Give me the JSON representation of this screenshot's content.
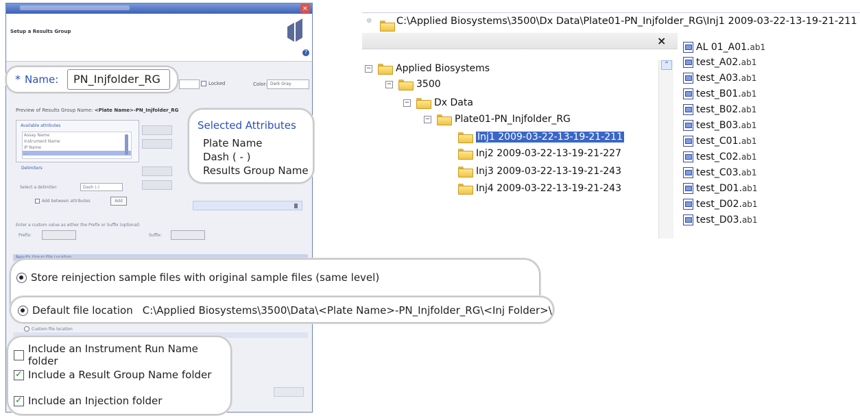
{
  "dialog": {
    "title_blurred": "",
    "setup_heading": "Setup a Results Group",
    "name_label": "Name:",
    "name_required_star": "*",
    "name_value": "PN_Injfolder_RG",
    "locked_label": "Locked",
    "color_label": "Color:",
    "color_value": "Dark Gray",
    "preview_label": "Preview of Results Group Name: ",
    "preview_value": "<Plate Name>-PN_Injfolder_RG",
    "available_attributes_header": "Available attributes",
    "available_attributes": [
      "Assay Name",
      "Instrument Name",
      "IP Name",
      "..."
    ],
    "delimiters_header": "Delimiters",
    "select_delimiter_label": "Select a delimiter:",
    "select_delimiter_value": "Dash (-)",
    "add_delimiter_label": "Add between attributes",
    "add_button": "Add",
    "custom_value_label": "Enter a custom value as either the Prefix or Suffix (optional)",
    "prefix_label": "Prefix:",
    "suffix_label": "Suffix:",
    "file_location_section": "Results Group File Location",
    "custom_location_label": "Custom file location",
    "selected_attributes": {
      "title": "Selected Attributes",
      "items": [
        "Plate Name",
        "Dash ( - )",
        "Results Group Name"
      ]
    },
    "store_reinjection": "Store reinjection sample files with original sample files (same level)",
    "default_location_label": "Default file location",
    "default_location_path": "C:\\Applied Biosystems\\3500\\Data\\<Plate Name>-PN_Injfolder_RG\\<Inj Folder>\\",
    "checkboxes": [
      {
        "label": "Include an Instrument Run Name folder",
        "checked": false
      },
      {
        "label": "Include a Result Group Name folder",
        "checked": true
      },
      {
        "label": "Include an Injection folder",
        "checked": true
      }
    ]
  },
  "explorer": {
    "address_path": "C:\\Applied Biosystems\\3500\\Dx Data\\Plate01-PN_Injfolder_RG\\Inj1 2009-03-22-13-19-21-211",
    "close_symbol": "×",
    "tree": [
      {
        "label": "Applied Biosystems",
        "expander": "⊟"
      },
      {
        "label": "3500",
        "expander": "⊟"
      },
      {
        "label": "Dx Data",
        "expander": "⊟"
      },
      {
        "label": "Plate01-PN_Injfolder_RG",
        "expander": "⊟"
      },
      {
        "label": "Inj1 2009-03-22-13-19-21-211",
        "selected": true
      },
      {
        "label": "Inj2 2009-03-22-13-19-21-227"
      },
      {
        "label": "Inj3 2009-03-22-13-19-21-243"
      },
      {
        "label": "Inj4 2009-03-22-13-19-21-243"
      }
    ],
    "files": [
      {
        "name": "AL 01_A01.",
        "ext": "ab1"
      },
      {
        "name": "test_A02.",
        "ext": "ab1"
      },
      {
        "name": "test_A03.",
        "ext": "ab1"
      },
      {
        "name": "test_B01.",
        "ext": "ab1"
      },
      {
        "name": "test_B02.",
        "ext": "ab1"
      },
      {
        "name": "test_B03.",
        "ext": "ab1"
      },
      {
        "name": "test_C01.",
        "ext": "ab1"
      },
      {
        "name": "test_C02.",
        "ext": "ab1"
      },
      {
        "name": "test_C03.",
        "ext": "ab1"
      },
      {
        "name": "test_D01.",
        "ext": "ab1"
      },
      {
        "name": "test_D02.",
        "ext": "ab1"
      },
      {
        "name": "test_D03.",
        "ext": "ab1"
      }
    ]
  }
}
